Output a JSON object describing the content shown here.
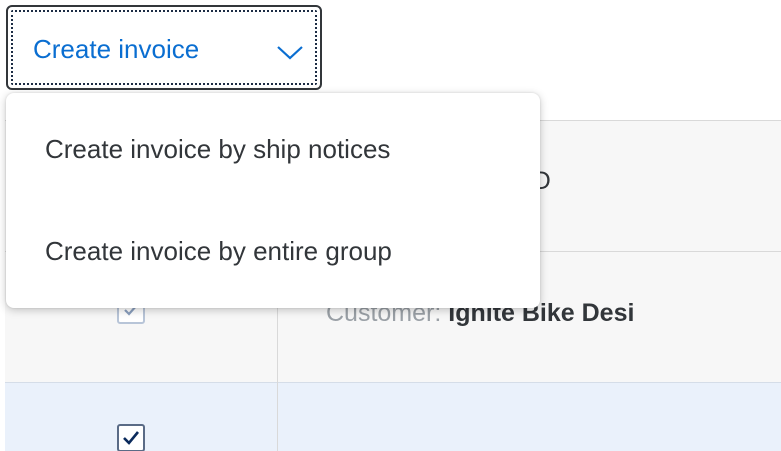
{
  "toolbar": {
    "create_invoice_label": "Create invoice",
    "create_invoice_icon": "chevron-down-icon"
  },
  "menu": {
    "items": [
      {
        "label": "Create invoice by ship notices"
      },
      {
        "label": "Create invoice by entire group"
      }
    ]
  },
  "table": {
    "header": {
      "visible_column_label": "p ID"
    },
    "rows": [
      {
        "type": "group",
        "expand_icon": "chevron-down-icon",
        "checked": true,
        "customer_prefix": "Customer: ",
        "customer_name": "Ignite Bike Desi"
      },
      {
        "type": "item",
        "checked": true,
        "selected": true
      }
    ]
  },
  "colors": {
    "accent": "#0a6ed1",
    "text": "#32363a",
    "muted_text": "#9aa0a6",
    "selected_row_bg": "#eaf1fb",
    "header_bg": "#f7f7f7"
  }
}
